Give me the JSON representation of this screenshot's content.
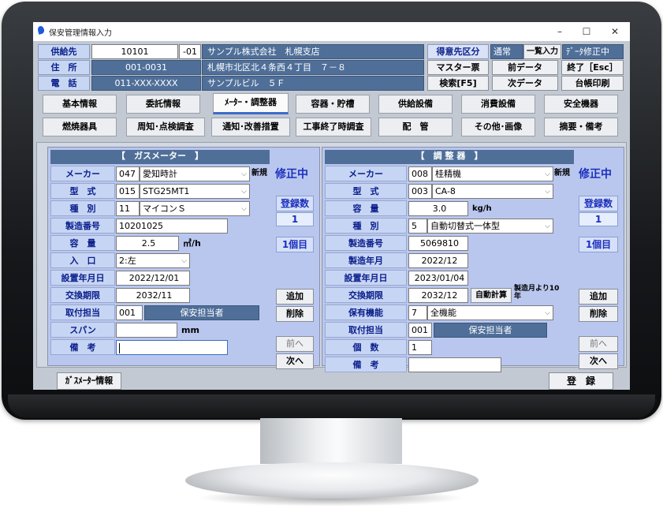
{
  "window": {
    "title": "保安管理情報入力",
    "controls": [
      "–",
      "☐",
      "✕"
    ]
  },
  "header": {
    "supplier_label": "供給先",
    "supplier_code": "10101",
    "supplier_sub": "-01",
    "supplier_name": "サンプル株式会社　札幌支店",
    "address_label": "住　所",
    "postal": "001-0031",
    "address": "札幌市北区北４条西４丁目　７－８",
    "phone_label": "電　話",
    "phone": "011-XXX-XXXX",
    "building": "サンプルビル　５Ｆ",
    "customer_class_label": "得意先区分",
    "customer_class_value": "通常",
    "list_input": "一覧入力",
    "data_editing": "ﾃﾞｰﾀ修正中",
    "master_ticket": "マスター票",
    "prev_data": "前データ",
    "exit": "終了［Esc］",
    "search": "検索[F5]",
    "next_data": "次データ",
    "ledger_print": "台帳印刷"
  },
  "tabs_row1": [
    "基本情報",
    "委託情報",
    "ﾒｰﾀｰ・調整器",
    "容器・貯槽",
    "供給設備",
    "消費設備",
    "安全機器"
  ],
  "tabs_row2": [
    "燃焼器具",
    "周知･点検調査",
    "通知･改善措置",
    "工事終了時調査",
    "配　管",
    "その他･画像",
    "摘要・備考"
  ],
  "gas_meter": {
    "title": "【　ガスメーター　】",
    "status": "修正中",
    "count_label": "登録数",
    "count_value": "1",
    "position": "1個目",
    "new_label": "新規",
    "add": "追加",
    "delete": "削除",
    "prev": "前へ",
    "next": "次へ",
    "fields": {
      "maker_label": "メーカー",
      "maker_code": "047",
      "maker_name": "愛知時計",
      "model_label": "型　式",
      "model_code": "015",
      "model_name": "STG25MT1",
      "type_label": "種　別",
      "type_code": "11",
      "type_name": "マイコンＳ",
      "serial_label": "製造番号",
      "serial": "10201025",
      "capacity_label": "容　量",
      "capacity": "2.5",
      "capacity_unit": "㎥/h",
      "inlet_label": "入　口",
      "inlet": "2:左",
      "install_label": "設置年月日",
      "install_date": "2022/12/01",
      "expiry_label": "交換期限",
      "expiry": "2032/11",
      "installer_label": "取付担当",
      "installer_code": "001",
      "installer_name": "保安担当者",
      "span_label": "スパン",
      "span_unit": "mm",
      "notes_label": "備　考"
    }
  },
  "regulator": {
    "title": "【　調 整 器　】",
    "status": "修正中",
    "count_label": "登録数",
    "count_value": "1",
    "position": "1個目",
    "new_label": "新規",
    "add": "追加",
    "delete": "削除",
    "prev": "前へ",
    "next": "次へ",
    "fields": {
      "maker_label": "メーカー",
      "maker_code": "008",
      "maker_name": "桂精機",
      "model_label": "型　式",
      "model_code": "003",
      "model_name": "CA-8",
      "capacity_label": "容　量",
      "capacity": "3.0",
      "capacity_unit": "kg/h",
      "type_label": "種　別",
      "type_code": "5",
      "type_name": "自動切替式一体型",
      "serial_label": "製造番号",
      "serial": "5069810",
      "mfg_label": "製造年月",
      "mfg_date": "2022/12",
      "install_label": "設置年月日",
      "install_date": "2023/01/04",
      "expiry_label": "交換期限",
      "expiry": "2032/12",
      "auto_calc": "自動計算",
      "auto_note": "製造月より10年",
      "feature_label": "保有機能",
      "feature_code": "7",
      "feature_name": "全機能",
      "installer_label": "取付担当",
      "installer_code": "001",
      "installer_name": "保安担当者",
      "qty_label": "個　数",
      "qty": "1",
      "notes_label": "備　考"
    }
  },
  "footer": {
    "meter_info": "ｶﾞｽﾒｰﾀｰ情報",
    "register": "登　録"
  }
}
